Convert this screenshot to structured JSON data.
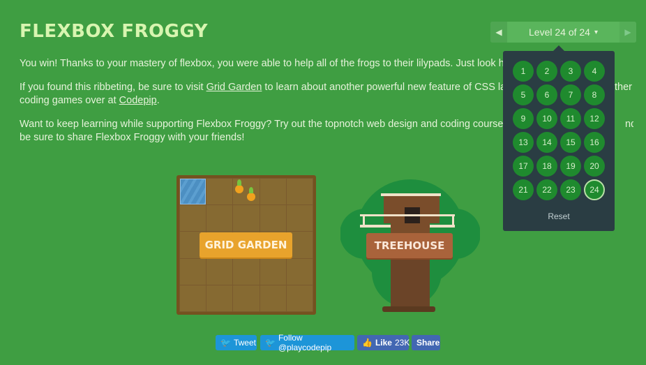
{
  "title": "FLEXBOX FROGGY",
  "paragraphs": {
    "p1": "You win! Thanks to your mastery of flexbox, you were able to help all of the frogs to their lilypads. Just look h",
    "p2_pre": "If you found this ribbeting, be sure to visit ",
    "p2_link1": "Grid Garden",
    "p2_mid": " to learn about another powerful new feature of CSS la",
    "p2_tail": "ther",
    "p2_line2_pre": "coding games over at ",
    "p2_link2": "Codepip",
    "p2_line2_post": ".",
    "p3_line1": "Want to keep learning while supporting Flexbox Froggy? Try out the topnotch web design and coding course",
    "p3_tail": "nd",
    "p3_line2": "be sure to share Flexbox Froggy with your friends!"
  },
  "level_nav": {
    "prev_icon": "◀",
    "next_icon": "▶",
    "label": "Level 24 of 24",
    "caret": "▾",
    "levels": [
      "1",
      "2",
      "3",
      "4",
      "5",
      "6",
      "7",
      "8",
      "9",
      "10",
      "11",
      "12",
      "13",
      "14",
      "15",
      "16",
      "17",
      "18",
      "19",
      "20",
      "21",
      "22",
      "23",
      "24"
    ],
    "current": "24",
    "reset": "Reset"
  },
  "cards": {
    "grid_garden": "GRID GARDEN",
    "treehouse": "TREEHOUSE"
  },
  "social": {
    "tweet": "Tweet",
    "follow": "Follow @playcodepip",
    "like": "Like",
    "like_count": "23K",
    "share": "Share"
  },
  "colors": {
    "background": "#3f9e42",
    "title": "#d8f5b0",
    "level_panel": "#2a3d43",
    "level_button": "#1f8a2e",
    "garden_button": "#e8a32c",
    "treehouse_button": "#a9633b",
    "twitter": "#1d95d8",
    "facebook": "#4267b2"
  }
}
